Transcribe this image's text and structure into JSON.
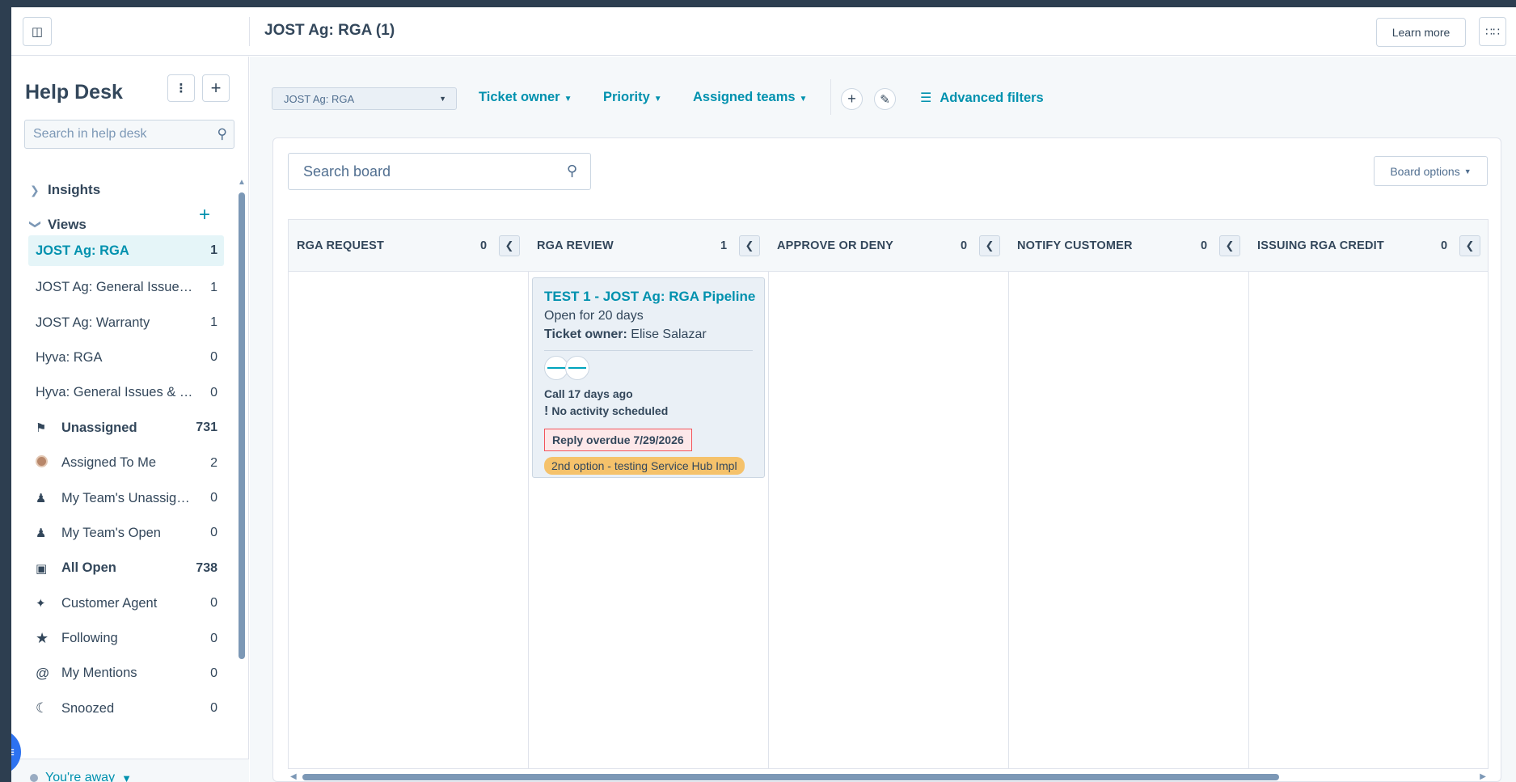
{
  "header": {
    "title": "JOST Ag: RGA (1)",
    "learn_more": "Learn more"
  },
  "sidebar": {
    "title": "Help Desk",
    "search_placeholder": "Search in help desk",
    "insights_label": "Insights",
    "views_label": "Views",
    "items": [
      {
        "label": "JOST Ag: RGA",
        "count": "1"
      },
      {
        "label": "JOST Ag: General Issues &...",
        "count": "1"
      },
      {
        "label": "JOST Ag: Warranty",
        "count": "1"
      },
      {
        "label": "Hyva: RGA",
        "count": "0"
      },
      {
        "label": "Hyva: General Issues & C...",
        "count": "0"
      },
      {
        "label": "Unassigned",
        "count": "731",
        "icon": "unassigned-icon"
      },
      {
        "label": "Assigned To Me",
        "count": "2",
        "icon": "avatar-icon"
      },
      {
        "label": "My Team's Unassigned",
        "count": "0",
        "icon": "team-icon"
      },
      {
        "label": "My Team's Open",
        "count": "0",
        "icon": "team-icon"
      },
      {
        "label": "All Open",
        "count": "738",
        "icon": "inbox-icon"
      },
      {
        "label": "Customer Agent",
        "count": "0",
        "icon": "sparkle-icon"
      },
      {
        "label": "Following",
        "count": "0",
        "icon": "star-icon"
      },
      {
        "label": "My Mentions",
        "count": "0",
        "icon": "at-icon"
      },
      {
        "label": "Snoozed",
        "count": "0",
        "icon": "moon-icon"
      }
    ],
    "status": "You're away"
  },
  "filters": {
    "pipeline": "JOST Ag: RGA",
    "ticket_owner": "Ticket owner",
    "priority": "Priority",
    "assigned_teams": "Assigned teams",
    "advanced_filters": "Advanced filters"
  },
  "board": {
    "search_placeholder": "Search board",
    "options_label": "Board options",
    "columns": [
      {
        "title": "RGA REQUEST",
        "count": "0"
      },
      {
        "title": "RGA REVIEW",
        "count": "1"
      },
      {
        "title": "APPROVE OR DENY",
        "count": "0"
      },
      {
        "title": "NOTIFY CUSTOMER",
        "count": "0"
      },
      {
        "title": "ISSUING RGA CREDIT",
        "count": "0"
      }
    ],
    "card": {
      "title": "TEST 1 - JOST Ag: RGA Pipeline",
      "open_for": "Open for 20 days",
      "owner_label": "Ticket owner:",
      "owner_name": "Elise Salazar",
      "last_activity": "Call 17 days ago",
      "next_activity": "No activity scheduled",
      "overdue": "Reply overdue 7/29/2026",
      "tag": "2nd option - testing Service Hub Impl"
    }
  },
  "colors": {
    "accent": "#0091ae",
    "text": "#33475b",
    "overdue_border": "#f2545b",
    "tag_bg": "#f5c26b",
    "active_item_bg": "#e5f5f8"
  }
}
